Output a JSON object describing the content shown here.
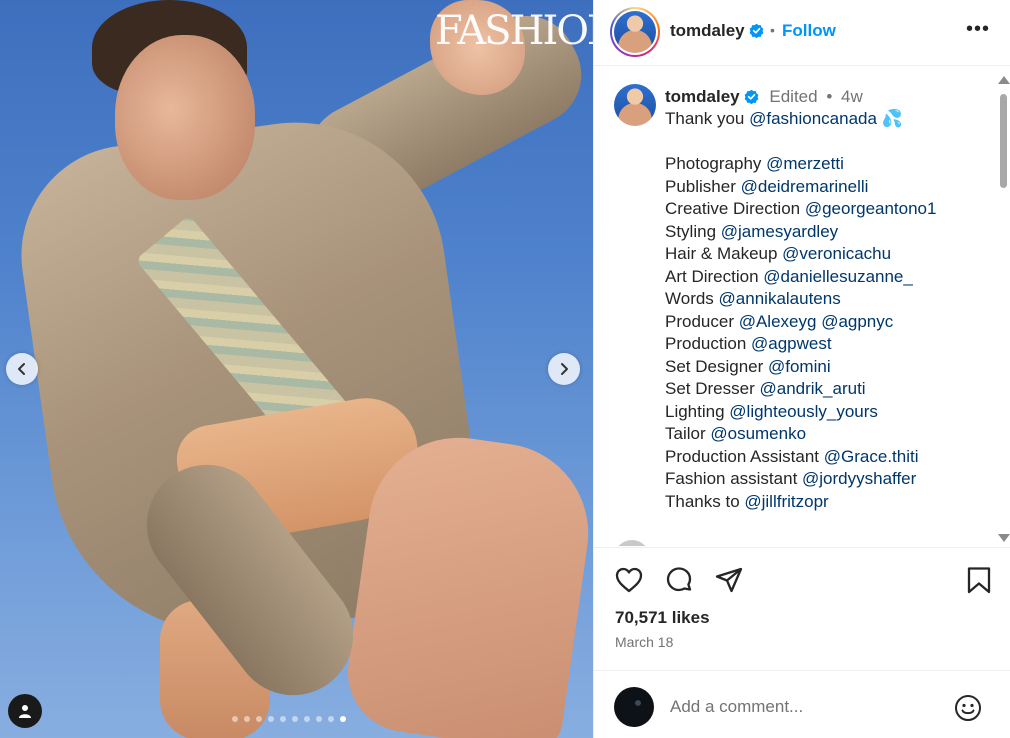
{
  "media": {
    "brand_text": "FASHION",
    "slide_count": 10,
    "active_slide": 9
  },
  "header": {
    "username": "tomdaley",
    "separator": "•",
    "follow_label": "Follow",
    "more_label": "•••"
  },
  "caption": {
    "username": "tomdaley",
    "edited": "Edited",
    "meta_sep": "•",
    "age": "4w",
    "lines": [
      {
        "prefix": "Thank you ",
        "mention": "@fashioncanada",
        "suffix": " 💦"
      },
      {
        "blank": true
      },
      {
        "prefix": "Photography ",
        "mention": "@merzetti"
      },
      {
        "prefix": "Publisher ",
        "mention": "@deidremarinelli"
      },
      {
        "prefix": "Creative Direction ",
        "mention": "@georgeantono1"
      },
      {
        "prefix": "Styling ",
        "mention": "@jamesyardley"
      },
      {
        "prefix": "Hair & Makeup ",
        "mention": "@veronicachu"
      },
      {
        "prefix": "Art Direction ",
        "mention": "@daniellesuzanne_"
      },
      {
        "prefix": "Words ",
        "mention": "@annikalautens"
      },
      {
        "prefix": "Producer ",
        "mention": "@Alexeyg",
        "suffix": " ",
        "mention2": "@agpnyc"
      },
      {
        "prefix": "Production ",
        "mention": "@agpwest"
      },
      {
        "prefix": "Set Designer ",
        "mention": "@fomini"
      },
      {
        "prefix": "Set Dresser ",
        "mention": "@andrik_aruti"
      },
      {
        "prefix": "Lighting ",
        "mention": "@lighteously_yours"
      },
      {
        "prefix": "Tailor ",
        "mention": "@osumenko"
      },
      {
        "prefix": "Production Assistant ",
        "mention": "@Grace.thiti"
      },
      {
        "prefix": "Fashion assistant ",
        "mention": "@jordyyshaffer"
      },
      {
        "prefix": "Thanks to ",
        "mention": "@jillfritzopr"
      }
    ]
  },
  "actions": {
    "likes": "70,571 likes",
    "date": "March 18"
  },
  "comment": {
    "placeholder": "Add a comment..."
  },
  "colors": {
    "link_blue": "#0095f6",
    "mention": "#00376b",
    "verified": "#0095f6"
  }
}
